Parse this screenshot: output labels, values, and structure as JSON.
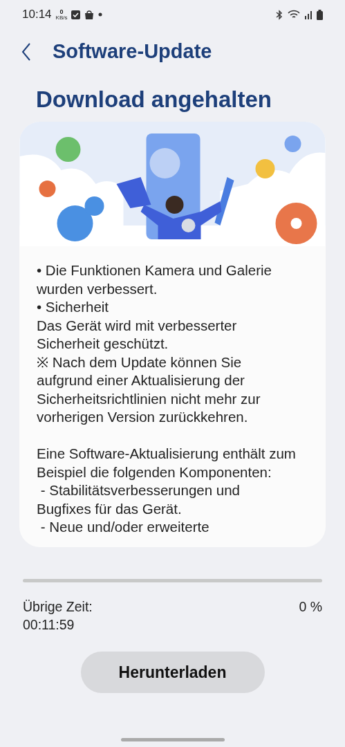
{
  "status_bar": {
    "time": "10:14",
    "net_speed": "0",
    "net_unit": "KB/s"
  },
  "header": {
    "title": "Software-Update"
  },
  "heading": "Download angehalten",
  "notes": [
    {
      "kind": "text",
      "text": "• Die Funktionen Kamera und Galerie wurden verbessert."
    },
    {
      "kind": "text",
      "text": "• Sicherheit"
    },
    {
      "kind": "text",
      "text": "Das Gerät wird mit verbesserter Sicherheit geschützt."
    },
    {
      "kind": "text",
      "text": "※ Nach dem Update können Sie aufgrund einer Aktualisierung der Sicherheitsrichtlinien nicht mehr zur vorherigen Version zurückkehren."
    },
    {
      "kind": "gap"
    },
    {
      "kind": "text",
      "text": "Eine Software-Aktualisierung enthält zum Beispiel die folgenden Komponenten:"
    },
    {
      "kind": "text",
      "text": " - Stabilitätsverbesserungen und Bugfixes für das Gerät."
    },
    {
      "kind": "text",
      "text": " - Neue und/oder erweiterte"
    }
  ],
  "progress": {
    "level": 0,
    "remaining_label": "Übrige Zeit:",
    "remaining_time": "00:11:59",
    "percent": "0 %"
  },
  "button": "Herunterladen"
}
